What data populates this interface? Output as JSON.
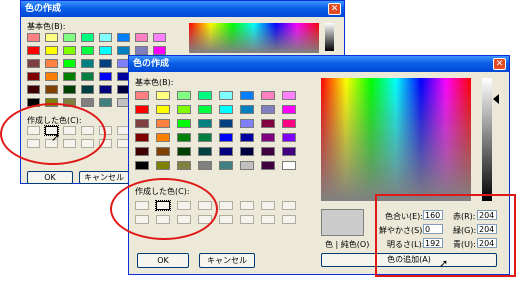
{
  "dialog": {
    "title": "色の作成",
    "basic_colors_label": "基本色(B):",
    "custom_colors_label": "作成した色(C):",
    "ok_label": "OK",
    "cancel_label": "キャンセル",
    "add_color_label": "色の追加(A)",
    "solid_color_label": "色 | 純色(O)",
    "close_glyph": "✕"
  },
  "fields": {
    "hue": {
      "label": "色合い(E):",
      "value": "160"
    },
    "sat": {
      "label": "鮮やかさ(S):",
      "value": "0"
    },
    "lum": {
      "label": "明るさ(L):",
      "value": "192"
    },
    "red": {
      "label": "赤(R):",
      "value": "204"
    },
    "green": {
      "label": "緑(G):",
      "value": "204"
    },
    "blue": {
      "label": "青(U):",
      "value": "204"
    }
  },
  "colors": {
    "preview": "#cccccc",
    "highlight": "#e01818",
    "basic": [
      "#ff8080",
      "#ffff80",
      "#80ff80",
      "#00ff80",
      "#80ffff",
      "#0080ff",
      "#ff80c0",
      "#ff80ff",
      "#ff0000",
      "#ffff00",
      "#80ff00",
      "#00ff40",
      "#00ffff",
      "#0080c0",
      "#8080c0",
      "#ff00ff",
      "#804040",
      "#ff8040",
      "#00ff00",
      "#008080",
      "#004080",
      "#8080ff",
      "#800040",
      "#ff0080",
      "#800000",
      "#ff8000",
      "#008000",
      "#008040",
      "#0000ff",
      "#0000a0",
      "#800080",
      "#8000ff",
      "#400000",
      "#804000",
      "#004000",
      "#004040",
      "#000080",
      "#000040",
      "#400040",
      "#400080",
      "#000000",
      "#808000",
      "#808040",
      "#808080",
      "#408080",
      "#c0c0c0",
      "#400040",
      "#ffffff"
    ]
  }
}
